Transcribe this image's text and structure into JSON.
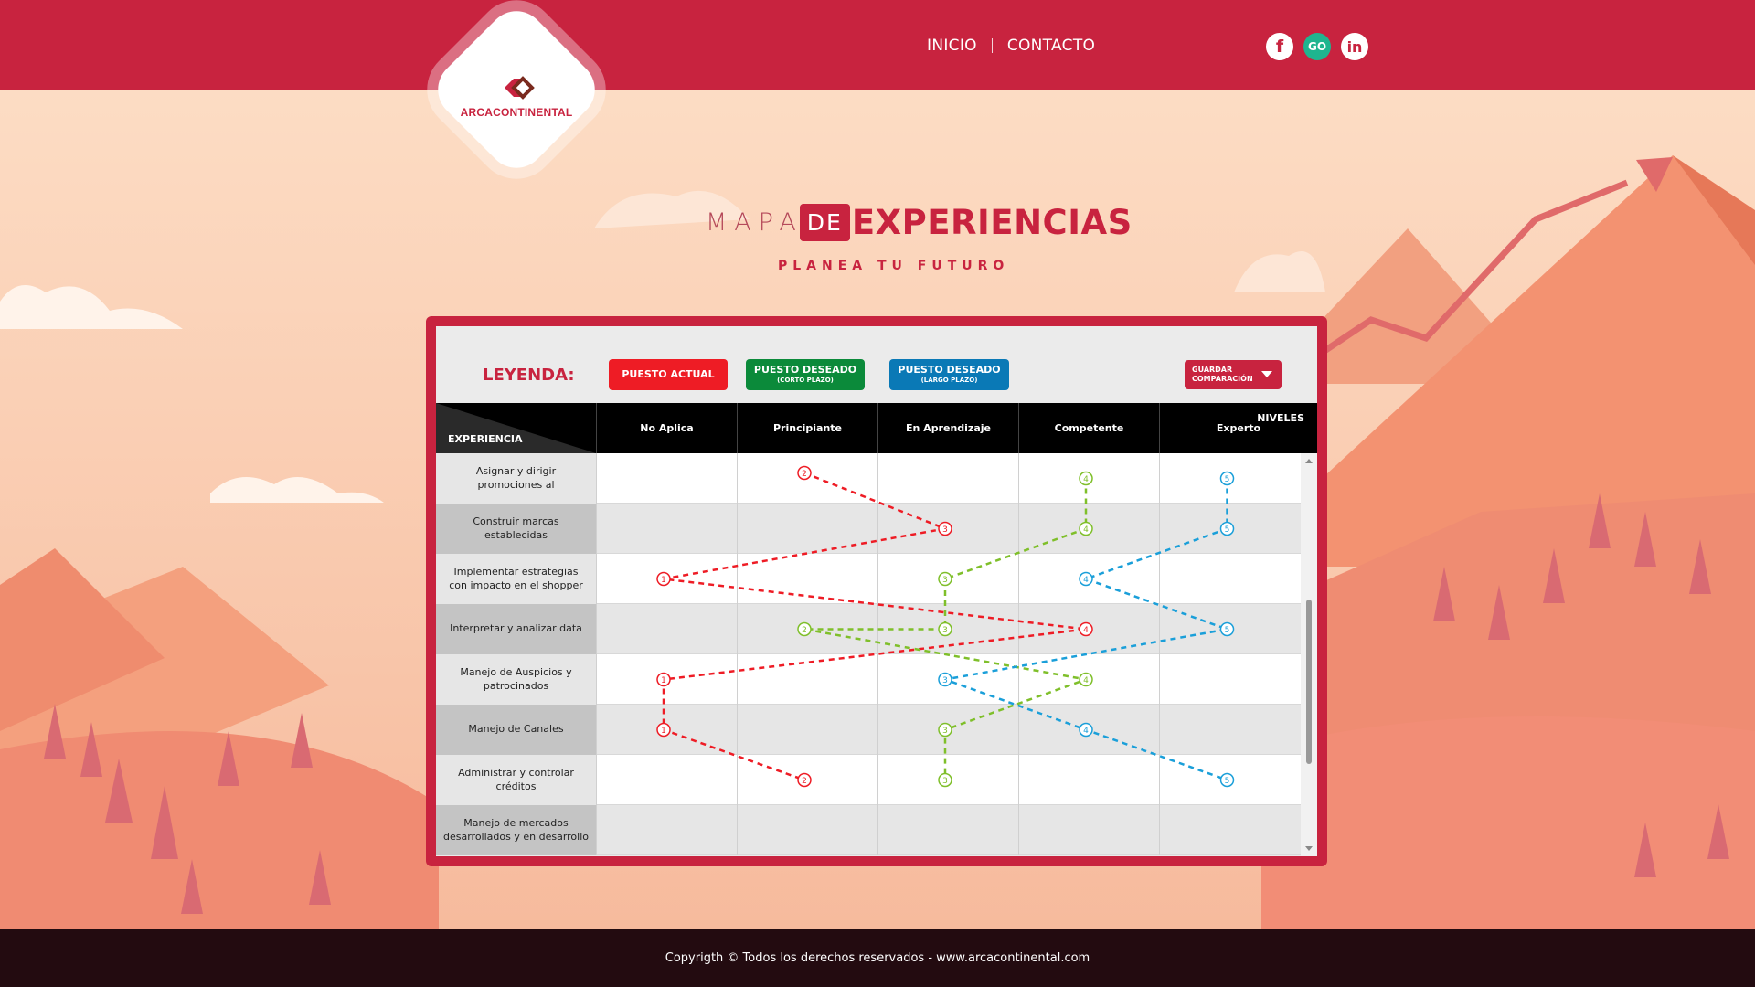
{
  "nav": {
    "items": [
      {
        "label": "INICIO"
      },
      {
        "label": "CONTACTO"
      }
    ]
  },
  "social": {
    "facebook": "f",
    "go": "GO",
    "linkedin": "in"
  },
  "logo": {
    "text": "ARCACONTINENTAL"
  },
  "title": {
    "light": "MAPA",
    "box": "DE",
    "bold": "EXPERIENCIAS",
    "subtitle": "PLANEA TU FUTURO"
  },
  "legend": {
    "title": "LEYENDA:",
    "actual": "PUESTO ACTUAL",
    "short": {
      "label": "PUESTO DESEADO",
      "sub": "(CORTO PLAZO)"
    },
    "long": {
      "label": "PUESTO DESEADO",
      "sub": "(LARGO PLAZO)"
    },
    "save": {
      "line1": "GUARDAR",
      "line2": "COMPARACIÓN"
    }
  },
  "grid": {
    "corner_top": "NIVELES",
    "corner_bottom": "EXPERIENCIA",
    "levels": [
      "No Aplica",
      "Principiante",
      "En Aprendizaje",
      "Competente",
      "Experto"
    ],
    "rows": [
      "Asignar y dirigir promociones al",
      "Construir marcas establecidas",
      "Implementar estrategias con impacto en el shopper",
      "Interpretar y analizar data",
      "Manejo de Auspicios y patrocinados",
      "Manejo de Canales",
      "Administrar y controlar créditos",
      "Manejo de mercados desarrollados y en desarrollo"
    ]
  },
  "colors": {
    "brand": "#c8233f",
    "actual": "#ee1c25",
    "short": "#7fbf2a",
    "short_legend": "#0b8a3a",
    "long": "#1a9fd9",
    "long_legend": "#0a79b6",
    "footer": "#230b10"
  },
  "series": [
    {
      "key": "actual",
      "color": "#ee1c25",
      "points": [
        [
          0,
          2
        ],
        [
          1,
          3
        ],
        [
          2,
          1
        ],
        [
          3,
          4
        ],
        [
          4,
          1
        ],
        [
          5,
          1
        ],
        [
          6,
          2
        ]
      ]
    },
    {
      "key": "short",
      "color": "#7fbf2a",
      "points": [
        [
          0,
          4
        ],
        [
          1,
          4
        ],
        [
          2,
          3
        ],
        [
          3,
          3
        ],
        [
          3,
          2
        ],
        [
          4,
          4
        ],
        [
          5,
          3
        ],
        [
          6,
          3
        ]
      ]
    },
    {
      "key": "long",
      "color": "#1a9fd9",
      "points": [
        [
          0,
          5
        ],
        [
          1,
          5
        ],
        [
          2,
          4
        ],
        [
          3,
          5
        ],
        [
          4,
          3
        ],
        [
          5,
          4
        ],
        [
          6,
          5
        ]
      ]
    }
  ],
  "footer": {
    "text": "Copyrigth © Todos los derechos reservados - www.arcacontinental.com"
  }
}
